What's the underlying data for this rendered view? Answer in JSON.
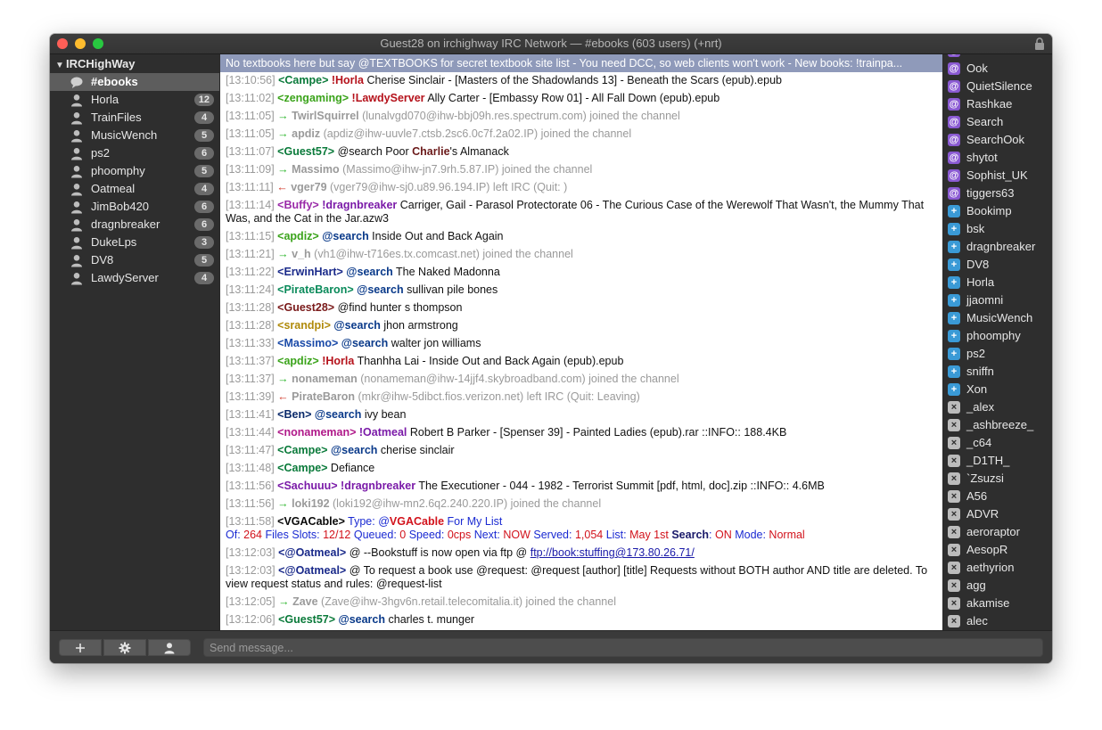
{
  "window": {
    "title": "Guest28 on irchighway IRC Network — #ebooks (603 users) (+nrt)"
  },
  "sidebar": {
    "network": "IRCHighWay",
    "items": [
      {
        "label": "#ebooks",
        "badge": "",
        "selected": true
      },
      {
        "label": "Horla",
        "badge": "12"
      },
      {
        "label": "TrainFiles",
        "badge": "4"
      },
      {
        "label": "MusicWench",
        "badge": "5"
      },
      {
        "label": "ps2",
        "badge": "6"
      },
      {
        "label": "phoomphy",
        "badge": "5"
      },
      {
        "label": "Oatmeal",
        "badge": "4"
      },
      {
        "label": "JimBob420",
        "badge": "6"
      },
      {
        "label": "dragnbreaker",
        "badge": "6"
      },
      {
        "label": "DukeLps",
        "badge": "3"
      },
      {
        "label": "DV8",
        "badge": "5"
      },
      {
        "label": "LawdyServer",
        "badge": "4"
      }
    ]
  },
  "topic": "No textbooks here but say @TEXTBOOKS for secret textbook site list - You need DCC, so web clients won't work - New books: !trainpa...",
  "log": {
    "l1": {
      "ts": "[13:10:56]",
      "nick": "<Campe>",
      "pre": " ",
      "target": "!Horla",
      "msg": " Cherise Sinclair - [Masters of the Shadowlands 13] - Beneath the Scars (epub).epub"
    },
    "l2": {
      "ts": "[13:11:02]",
      "nick": "<zengaming>",
      "pre": " ",
      "target": "!LawdyServer",
      "msg": " Ally Carter - [Embassy Row 01] - All Fall Down (epub).epub"
    },
    "l3": {
      "ts": "[13:11:05]",
      "arrow": "→",
      "nick": "TwirlSquirrel",
      "msg": " (lunalvgd070@ihw-bbj09h.res.spectrum.com) joined the channel"
    },
    "l4": {
      "ts": "[13:11:05]",
      "arrow": "→",
      "nick": "apdiz",
      "msg": " (apdiz@ihw-uuvle7.ctsb.2sc6.0c7f.2a02.IP) joined the channel"
    },
    "l5": {
      "ts": "[13:11:07]",
      "nick": "<Guest57>",
      "pre": " @search Poor ",
      "target": "Charlie",
      "msg": "'s Almanack"
    },
    "l6": {
      "ts": "[13:11:09]",
      "arrow": "→",
      "nick": "Massimo",
      "msg": " (Massimo@ihw-jn7.9rh.5.87.IP) joined the channel"
    },
    "l7": {
      "ts": "[13:11:11]",
      "arrow": "←",
      "nick": "vger79",
      "msg": " (vger79@ihw-sj0.u89.96.194.IP) left IRC (Quit: )"
    },
    "l8": {
      "ts": "[13:11:14]",
      "nick": "<Buffy>",
      "pre": " ",
      "target": "!dragnbreaker",
      "msg": " Carriger, Gail - Parasol Protectorate 06 - The Curious Case of the Werewolf That Wasn't, the Mummy That Was, and the Cat in the Jar.azw3"
    },
    "l9": {
      "ts": "[13:11:15]",
      "nick": "<apdiz>",
      "pre": " ",
      "target": "@search",
      "msg": " Inside Out and Back Again"
    },
    "l10": {
      "ts": "[13:11:21]",
      "arrow": "→",
      "nick": "v_h",
      "msg": " (vh1@ihw-t716es.tx.comcast.net) joined the channel"
    },
    "l11": {
      "ts": "[13:11:22]",
      "nick": "<ErwinHart>",
      "pre": " ",
      "target": "@search",
      "msg": " The Naked Madonna"
    },
    "l12": {
      "ts": "[13:11:24]",
      "nick": "<PirateBaron>",
      "pre": " ",
      "target": "@search",
      "msg": " sullivan pile bones"
    },
    "l13": {
      "ts": "[13:11:28]",
      "nick": "<Guest28>",
      "msg": " @find hunter s thompson"
    },
    "l14": {
      "ts": "[13:11:28]",
      "nick": "<srandpi>",
      "pre": " ",
      "target": "@search",
      "msg": " jhon armstrong"
    },
    "l15": {
      "ts": "[13:11:33]",
      "nick": "<Massimo>",
      "pre": " ",
      "target": "@search",
      "msg": " walter jon williams"
    },
    "l16": {
      "ts": "[13:11:37]",
      "nick": "<apdiz>",
      "pre": " ",
      "target": "!Horla",
      "msg": " Thanhha Lai - Inside Out and Back Again (epub).epub"
    },
    "l17": {
      "ts": "[13:11:37]",
      "arrow": "→",
      "nick": "nonameman",
      "msg": " (nonameman@ihw-14jjf4.skybroadband.com) joined the channel"
    },
    "l18": {
      "ts": "[13:11:39]",
      "arrow": "←",
      "nick": "PirateBaron",
      "msg": " (mkr@ihw-5dibct.fios.verizon.net) left IRC (Quit: Leaving)"
    },
    "l19": {
      "ts": "[13:11:41]",
      "nick": "<Ben>",
      "pre": " ",
      "target": "@search",
      "msg": " ivy bean"
    },
    "l20": {
      "ts": "[13:11:44]",
      "nick": "<nonameman>",
      "pre": " ",
      "target": "!Oatmeal",
      "msg": " Robert B Parker - [Spenser 39] - Painted Ladies (epub).rar  ::INFO:: 188.4KB"
    },
    "l21": {
      "ts": "[13:11:47]",
      "nick": "<Campe>",
      "pre": " ",
      "target": "@search",
      "msg": " cherise sinclair"
    },
    "l22": {
      "ts": "[13:11:48]",
      "nick": "<Campe>",
      "msg": " Defiance"
    },
    "l23": {
      "ts": "[13:11:56]",
      "nick": "<Sachuuu>",
      "pre": " ",
      "target": "!dragnbreaker",
      "msg": " The Executioner - 044 - 1982 - Terrorist Summit [pdf, html, doc].zip  ::INFO:: 4.6MB"
    },
    "l24": {
      "ts": "[13:11:56]",
      "arrow": "→",
      "nick": "loki192",
      "msg": " (loki192@ihw-mn2.6q2.240.220.IP) joined the channel"
    },
    "l25": {
      "ts": "[13:11:58]",
      "nick": "<VGACable>",
      "type_label": "  Type: @",
      "type_name": "VGACable",
      "type_rest": " For My List",
      "of": "Of: ",
      "of_v": "264",
      "files": " Files  Slots: ",
      "slots_v": "12/12",
      "queued": "  Queued: ",
      "queued_v": "0",
      "speed": "  Speed: ",
      "speed_v": "0cps",
      "next": "  Next: ",
      "next_v": "NOW",
      "served": "  Served: ",
      "served_v": "1,054",
      "list": "  List: ",
      "list_v": "May 1st",
      "search": "  Search",
      "search_colon": ": ",
      "search_v": "ON",
      "mode": "  Mode: ",
      "mode_v": "Normal"
    },
    "l26": {
      "ts": "[13:12:03]",
      "nick": "<@Oatmeal>",
      "msg": " @ --Bookstuff is now open via ftp @ ",
      "link": "ftp://book:stuffing@173.80.26.71/"
    },
    "l27": {
      "ts": "[13:12:03]",
      "nick": "<@Oatmeal>",
      "msg": " @ To request a book use @request: @request [author] [title] Requests without BOTH author AND title are deleted. To view request status and rules: @request-list"
    },
    "l28": {
      "ts": "[13:12:05]",
      "arrow": "→",
      "nick": "Zave",
      "msg": " (Zave@ihw-3hgv6n.retail.telecomitalia.it) joined the channel"
    },
    "l29": {
      "ts": "[13:12:06]",
      "nick": "<Guest57>",
      "pre": " ",
      "target": "@search",
      "msg": " charles t. munger"
    }
  },
  "users": [
    {
      "mark": "@",
      "name": "Catmeal",
      "kind": "op"
    },
    {
      "mark": "@",
      "name": "Ook",
      "kind": "op"
    },
    {
      "mark": "@",
      "name": "QuietSilence",
      "kind": "op"
    },
    {
      "mark": "@",
      "name": "Rashkae",
      "kind": "op"
    },
    {
      "mark": "@",
      "name": "Search",
      "kind": "op"
    },
    {
      "mark": "@",
      "name": "SearchOok",
      "kind": "op"
    },
    {
      "mark": "@",
      "name": "shytot",
      "kind": "op"
    },
    {
      "mark": "@",
      "name": "Sophist_UK",
      "kind": "op"
    },
    {
      "mark": "@",
      "name": "tiggers63",
      "kind": "op"
    },
    {
      "mark": "+",
      "name": "Bookimp",
      "kind": "voice"
    },
    {
      "mark": "+",
      "name": "bsk",
      "kind": "voice"
    },
    {
      "mark": "+",
      "name": "dragnbreaker",
      "kind": "voice"
    },
    {
      "mark": "+",
      "name": "DV8",
      "kind": "voice"
    },
    {
      "mark": "+",
      "name": "Horla",
      "kind": "voice"
    },
    {
      "mark": "+",
      "name": "jjaomni",
      "kind": "voice"
    },
    {
      "mark": "+",
      "name": "MusicWench",
      "kind": "voice"
    },
    {
      "mark": "+",
      "name": "phoomphy",
      "kind": "voice"
    },
    {
      "mark": "+",
      "name": "ps2",
      "kind": "voice"
    },
    {
      "mark": "+",
      "name": "sniffn",
      "kind": "voice"
    },
    {
      "mark": "+",
      "name": "Xon",
      "kind": "voice"
    },
    {
      "mark": "×",
      "name": "_alex",
      "kind": "none"
    },
    {
      "mark": "×",
      "name": "_ashbreeze_",
      "kind": "none"
    },
    {
      "mark": "×",
      "name": "_c64",
      "kind": "none"
    },
    {
      "mark": "×",
      "name": "_D1TH_",
      "kind": "none"
    },
    {
      "mark": "×",
      "name": "`Zsuzsi",
      "kind": "none"
    },
    {
      "mark": "×",
      "name": "A56",
      "kind": "none"
    },
    {
      "mark": "×",
      "name": "ADVR",
      "kind": "none"
    },
    {
      "mark": "×",
      "name": "aeroraptor",
      "kind": "none"
    },
    {
      "mark": "×",
      "name": "AesopR",
      "kind": "none"
    },
    {
      "mark": "×",
      "name": "aethyrion",
      "kind": "none"
    },
    {
      "mark": "×",
      "name": "agg",
      "kind": "none"
    },
    {
      "mark": "×",
      "name": "akamise",
      "kind": "none"
    },
    {
      "mark": "×",
      "name": "alec",
      "kind": "none"
    }
  ],
  "bottom": {
    "add_icon": "plus-icon",
    "settings_icon": "gear-icon",
    "user_icon": "person-icon",
    "send_placeholder": "Send message..."
  },
  "colors": {
    "topic_bg": "#8f9aba",
    "join": "#2ab52a",
    "part": "#d23a2a",
    "op": "#8a5ad2",
    "voice": "#3a9ad6"
  }
}
